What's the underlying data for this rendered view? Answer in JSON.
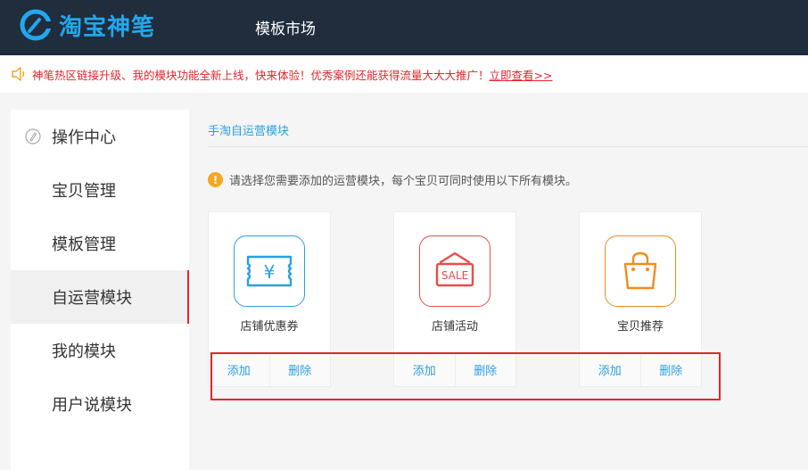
{
  "header": {
    "logo_text": "淘宝神笔",
    "market_label": "模板市场"
  },
  "notice": {
    "text": "神笔热区链接升级、我的模块功能全新上线，快来体验！优秀案例还能获得流量大大大推广！",
    "link": "立即查看>>"
  },
  "sidebar": {
    "items": [
      {
        "label": "操作中心"
      },
      {
        "label": "宝贝管理"
      },
      {
        "label": "模板管理"
      },
      {
        "label": "自运营模块"
      },
      {
        "label": "我的模块"
      },
      {
        "label": "用户说模块"
      }
    ],
    "active_index": 3
  },
  "main": {
    "breadcrumb": "手淘自运营模块",
    "tip": "请选择您需要添加的运营模块，每个宝贝可同时使用以下所有模块。",
    "cards": [
      {
        "name": "店铺优惠券",
        "add": "添加",
        "delete": "删除",
        "icon": "coupon-icon",
        "color": "#2ba0e0"
      },
      {
        "name": "店铺活动",
        "add": "添加",
        "delete": "删除",
        "icon": "sale-icon",
        "icon_text": "SALE",
        "color": "#e84c4c"
      },
      {
        "name": "宝贝推荐",
        "add": "添加",
        "delete": "删除",
        "icon": "bag-icon",
        "color": "#f08c1e"
      }
    ]
  },
  "colors": {
    "topbar": "#1f2d3d",
    "brand": "#22a8ee",
    "alert": "#e3262c",
    "link": "#2ba0e0"
  }
}
